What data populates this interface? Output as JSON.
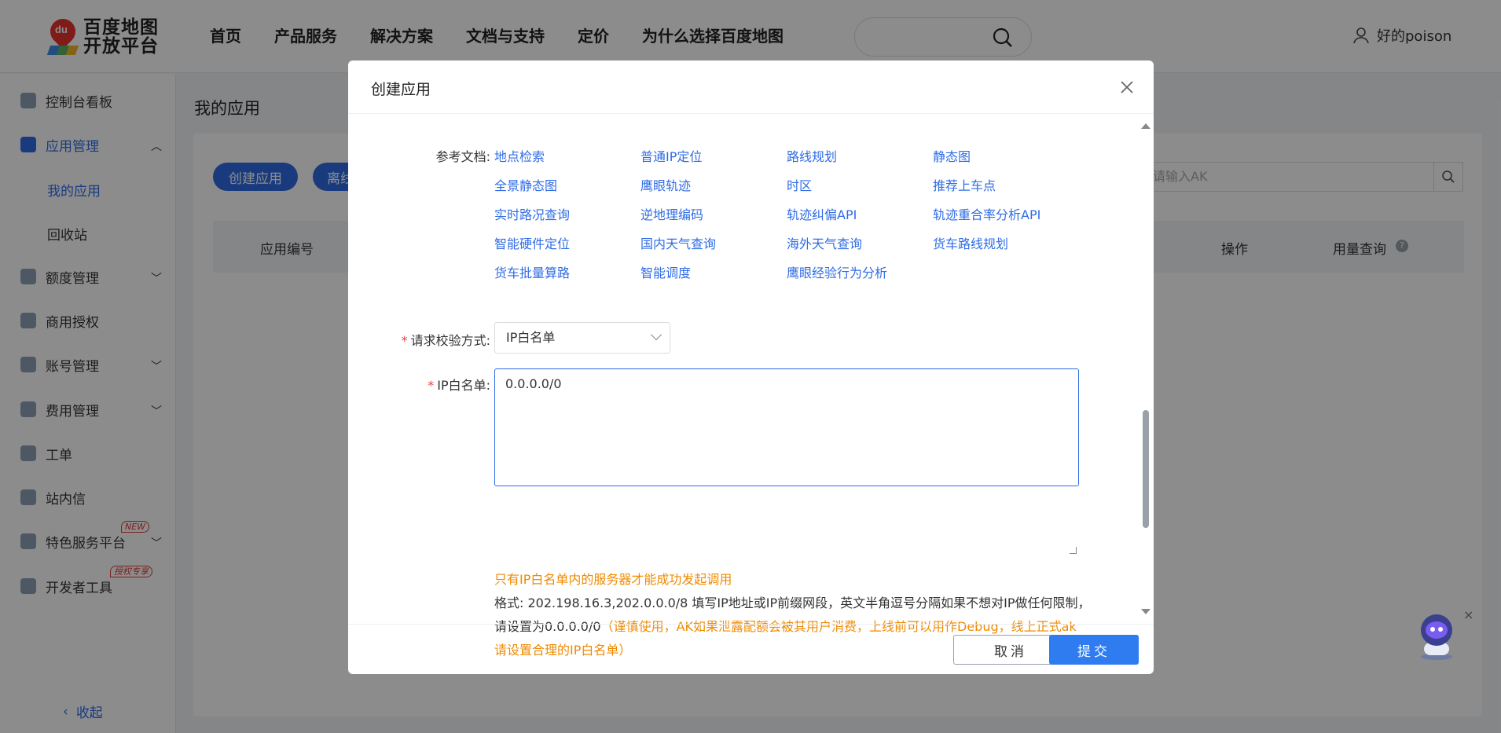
{
  "brand": {
    "line1": "百度地图",
    "line2": "开放平台",
    "pin_text": "du"
  },
  "nav": [
    "首页",
    "产品服务",
    "解决方案",
    "文档与支持",
    "定价",
    "为什么选择百度地图"
  ],
  "user": {
    "name": "好的poison"
  },
  "sidebar": {
    "items": [
      {
        "label": "控制台看板"
      },
      {
        "label": "应用管理"
      },
      {
        "label": "额度管理"
      },
      {
        "label": "商用授权"
      },
      {
        "label": "账号管理"
      },
      {
        "label": "费用管理"
      },
      {
        "label": "工单"
      },
      {
        "label": "站内信"
      },
      {
        "label": "特色服务平台",
        "badge": "NEW"
      },
      {
        "label": "开发者工具",
        "badge": "授权专享"
      }
    ],
    "sub": [
      "我的应用",
      "回收站"
    ],
    "collapse": "收起"
  },
  "page": {
    "title": "我的应用",
    "create_btn": "创建应用",
    "offline_btn": "离线",
    "ak_placeholder": "请输入AK",
    "columns": {
      "id": "应用编号",
      "ops": "操作",
      "usage": "用量查询"
    }
  },
  "modal": {
    "title": "创建应用",
    "doc_label": "参考文档:",
    "docs": [
      [
        "地点检索",
        "普通IP定位",
        "路线规划",
        "静态图"
      ],
      [
        "全景静态图",
        "鹰眼轨迹",
        "时区",
        "推荐上车点"
      ],
      [
        "实时路况查询",
        "逆地理编码",
        "轨迹纠偏API",
        "轨迹重合率分析API"
      ],
      [
        "智能硬件定位",
        "国内天气查询",
        "海外天气查询",
        "货车路线规划"
      ],
      [
        "货车批量算路",
        "智能调度",
        "鹰眼经验行为分析",
        ""
      ]
    ],
    "verify_label": "请求校验方式:",
    "verify_value": "IP白名单",
    "ip_label": "IP白名单:",
    "ip_value": "0.0.0.0/0",
    "hint_orange": "只有IP白名单内的服务器才能成功发起调用",
    "hint_line1": "格式: 202.198.16.3,202.0.0.0/8 填写IP地址或IP前缀网段，英文半角逗号分隔如果不想对IP做任何限制，",
    "hint_line2_prefix": "请设置为0.0.0.0/0",
    "hint_line2_warn": "（谨慎使用，AK如果泄露配额会被其用户消费，上线前可以用作Debug，线上正式ak",
    "hint_line3_warn": "请设置合理的IP白名单）",
    "cancel": "取消",
    "submit": "提交"
  },
  "colors": {
    "accent": "#2f6ce5",
    "warn": "#f08a00",
    "required": "#e54545"
  }
}
